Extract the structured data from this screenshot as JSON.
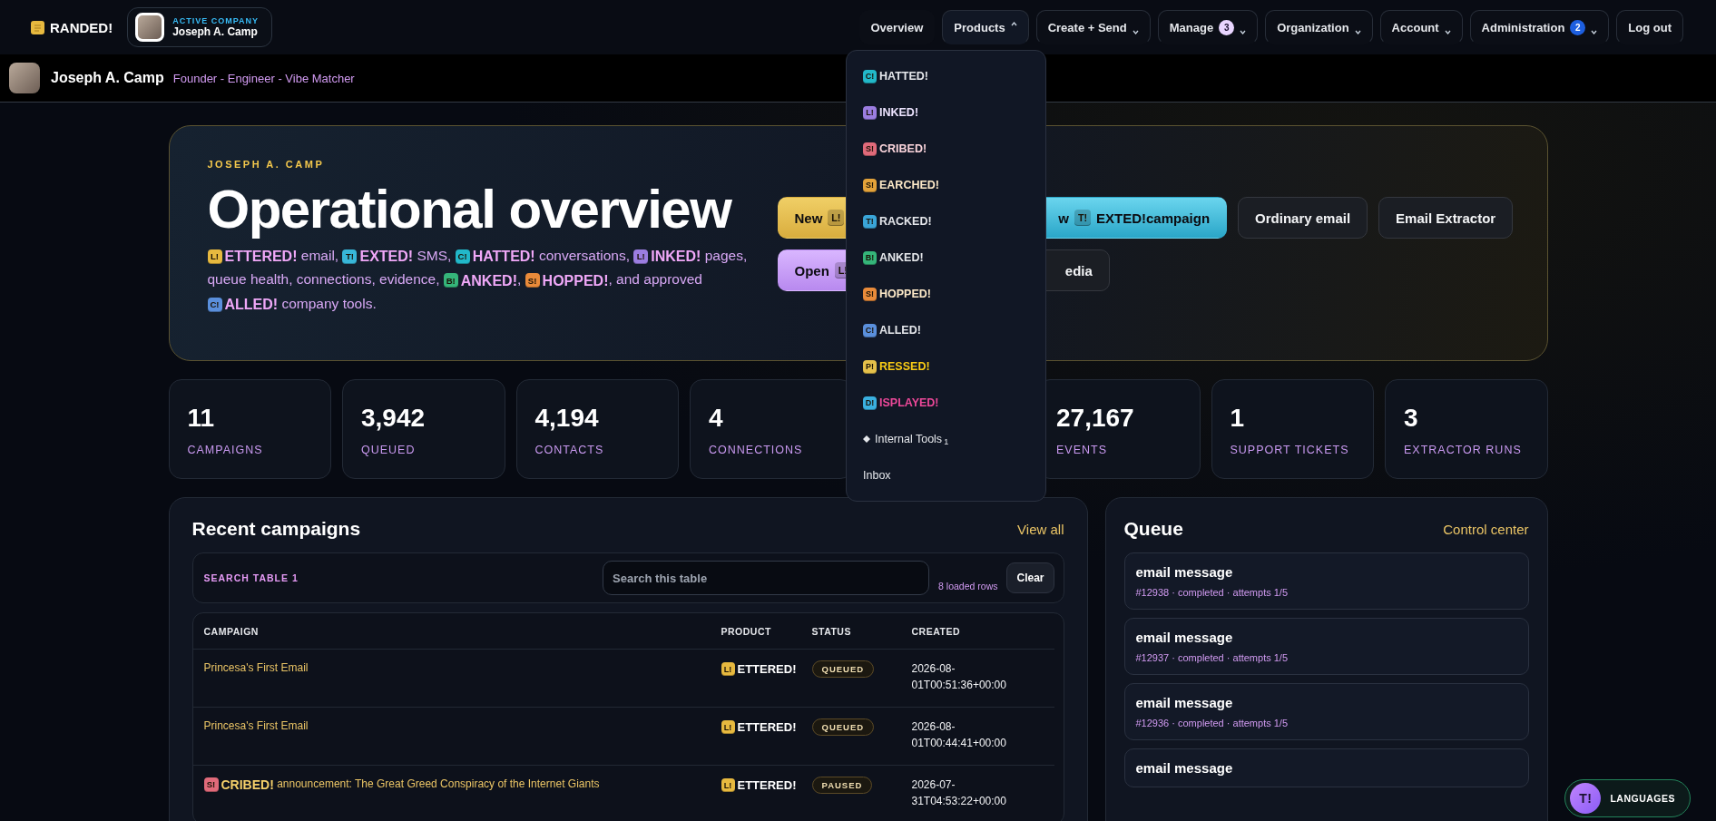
{
  "topbar": {
    "brand_name": "RANDED!",
    "company": {
      "caption": "ACTIVE COMPANY",
      "name": "Joseph A. Camp"
    },
    "nav": [
      {
        "label": "Overview",
        "kind": "link"
      },
      {
        "label": "Products",
        "kind": "menu",
        "expanded": true
      },
      {
        "label": "Create + Send",
        "kind": "menu",
        "expanded": false
      },
      {
        "label": "Manage",
        "kind": "menu",
        "expanded": false,
        "count": "3",
        "color": "#e9d5ff"
      },
      {
        "label": "Organization",
        "kind": "menu",
        "expanded": false
      },
      {
        "label": "Account",
        "kind": "menu",
        "expanded": false
      },
      {
        "label": "Administration",
        "kind": "menu",
        "expanded": false,
        "count": "2",
        "color": "#1d5fe0"
      },
      {
        "label": "Log out",
        "kind": "button"
      }
    ]
  },
  "profile": {
    "name": "Joseph A. Camp",
    "roles": "Founder - Engineer - Vibe Matcher"
  },
  "products_menu": [
    {
      "kind": "light",
      "badge": "C!",
      "color": "#22b8c9",
      "label": "HATTED!"
    },
    {
      "kind": "lilac",
      "badge": "L!",
      "color": "#9b7de0",
      "label": "INKED!"
    },
    {
      "kind": "rose",
      "badge": "S!",
      "color": "#e06a7a",
      "label": "CRIBED!"
    },
    {
      "kind": "cream",
      "badge": "S!",
      "color": "#e3a23a",
      "label": "EARCHED!"
    },
    {
      "kind": "light",
      "badge": "T!",
      "color": "#3aa5d8",
      "label": "RACKED!"
    },
    {
      "kind": "light",
      "badge": "B!",
      "color": "#35b57a",
      "label": "ANKED!"
    },
    {
      "kind": "cream",
      "badge": "S!",
      "color": "#e98b3a",
      "label": "HOPPED!"
    },
    {
      "kind": "light",
      "badge": "C!",
      "color": "#5a8fdc",
      "label": "ALLED!"
    },
    {
      "kind": "yellow",
      "badge": "P!",
      "color": "#e5c04a",
      "label": "RESSED!"
    },
    {
      "kind": "pink",
      "badge": "D!",
      "color": "#3ab0e0",
      "label": "ISPLAYED!"
    },
    {
      "kind": "tools",
      "label": "Internal Tools",
      "count": "1"
    },
    {
      "kind": "link",
      "label": "Inbox"
    }
  ],
  "hero": {
    "eyebrow": "JOSEPH A. CAMP",
    "title": "Operational overview",
    "description": [
      {
        "kind": "brand",
        "badge": "L!",
        "color": "#e7b93f",
        "label": "ETTERED!"
      },
      {
        "kind": "text",
        "text": " email, "
      },
      {
        "kind": "brand",
        "badge": "T!",
        "color": "#38b6d8",
        "label": "EXTED!"
      },
      {
        "kind": "text",
        "text": " SMS, "
      },
      {
        "kind": "brand",
        "badge": "C!",
        "color": "#22b8c9",
        "label": "HATTED!"
      },
      {
        "kind": "text",
        "text": " conversations, "
      },
      {
        "kind": "brand",
        "badge": "L!",
        "color": "#9b7de0",
        "label": "INKED!"
      },
      {
        "kind": "text",
        "text": " pages, queue health, connections, evidence, "
      },
      {
        "kind": "brand",
        "badge": "B!",
        "color": "#35b57a",
        "label": "ANKED!"
      },
      {
        "kind": "text",
        "text": ", "
      },
      {
        "kind": "brand",
        "badge": "S!",
        "color": "#e98b3a",
        "label": "HOPPED!"
      },
      {
        "kind": "text",
        "text": ", and approved "
      },
      {
        "kind": "brand",
        "badge": "C!",
        "color": "#5a8fdc",
        "label": "ALLED!"
      },
      {
        "kind": "text",
        "text": " company tools."
      }
    ],
    "action_rows": [
      [
        {
          "kind": "yellow",
          "text": "New",
          "badge": "L!"
        },
        {
          "kind": "cyan",
          "text": "w",
          "badge": "T!",
          "text_after": "EXTED!campaign"
        },
        {
          "kind": "dark",
          "text": "Ordinary email"
        },
        {
          "kind": "dark",
          "text": "Email Extractor"
        }
      ],
      [
        {
          "kind": "purple",
          "text": "Open",
          "badge": "L!"
        },
        {
          "kind": "dark",
          "text": "edia"
        }
      ]
    ]
  },
  "stats": [
    {
      "value": "11",
      "label": "CAMPAIGNS"
    },
    {
      "value": "3,942",
      "label": "QUEUED"
    },
    {
      "value": "4,194",
      "label": "CONTACTS"
    },
    {
      "value": "4",
      "label": "CONNECTIONS"
    },
    {
      "value": "27,167",
      "label": "EVENTS"
    },
    {
      "value": "1",
      "label": "SUPPORT TICKETS"
    },
    {
      "value": "3",
      "label": "EXTRACTOR RUNS"
    }
  ],
  "campaigns": {
    "title": "Recent campaigns",
    "link": "View all",
    "search": {
      "label": "SEARCH TABLE 1",
      "placeholder": "Search this table",
      "count": "8 loaded rows",
      "clear": "Clear"
    },
    "columns": [
      "CAMPAIGN",
      "PRODUCT",
      "STATUS",
      "CREATED"
    ],
    "rows": [
      {
        "campaign": [
          {
            "kind": "text",
            "text": "Princesa's First Email"
          }
        ],
        "product": {
          "badge": "L!",
          "color": "#e7b93f",
          "label": "ETTERED!"
        },
        "status": "QUEUED",
        "created": "2026-08-01T00:51:36+00:00"
      },
      {
        "campaign": [
          {
            "kind": "text",
            "text": "Princesa's First Email"
          }
        ],
        "product": {
          "badge": "L!",
          "color": "#e7b93f",
          "label": "ETTERED!"
        },
        "status": "QUEUED",
        "created": "2026-08-01T00:44:41+00:00"
      },
      {
        "campaign": [
          {
            "kind": "brand",
            "badge": "S!",
            "color": "#e06a7a",
            "label": "CRIBED!"
          },
          {
            "kind": "text",
            "text": " announcement: The Great Greed Conspiracy of the Internet Giants"
          }
        ],
        "product": {
          "badge": "L!",
          "color": "#e7b93f",
          "label": "ETTERED!"
        },
        "status": "PAUSED",
        "created": "2026-07-31T04:53:22+00:00"
      }
    ]
  },
  "queue": {
    "title": "Queue",
    "link": "Control center",
    "items": [
      {
        "title": "email message",
        "meta": "#12938 · completed · attempts 1/5"
      },
      {
        "title": "email message",
        "meta": "#12937 · completed · attempts 1/5"
      },
      {
        "title": "email message",
        "meta": "#12936 · completed · attempts 1/5"
      },
      {
        "title": "email message"
      }
    ]
  },
  "languages": {
    "badge": "T!",
    "label": "LANGUAGES"
  }
}
